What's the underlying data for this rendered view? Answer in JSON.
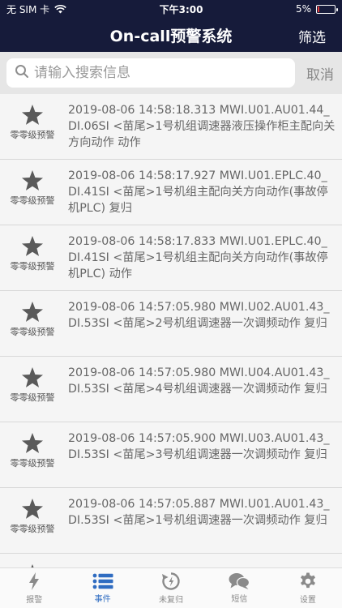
{
  "status_bar": {
    "carrier": "无 SIM 卡",
    "time": "下午3:00",
    "battery_text": "5%",
    "battery_level": 0.05,
    "battery_color": "#e23a3a"
  },
  "nav": {
    "title": "On-call预警系统",
    "filter_label": "筛选"
  },
  "search": {
    "placeholder": "请输入搜索信息",
    "cancel_label": "取消"
  },
  "alerts": [
    {
      "level": "零零级预警",
      "message": "2019-08-06 14:58:18.313 MWI.U01.AU01.44_DI.06SI <苗尾>1号机组调速器液压操作柜主配向关方向动作 动作"
    },
    {
      "level": "零零级预警",
      "message": "2019-08-06 14:58:17.927 MWI.U01.EPLC.40_DI.41SI <苗尾>1号机组主配向关方向动作(事故停机PLC) 复归"
    },
    {
      "level": "零零级预警",
      "message": "2019-08-06 14:58:17.833 MWI.U01.EPLC.40_DI.41SI <苗尾>1号机组主配向关方向动作(事故停机PLC) 动作"
    },
    {
      "level": "零零级预警",
      "message": "2019-08-06 14:57:05.980 MWI.U02.AU01.43_DI.53SI <苗尾>2号机组调速器一次调频动作 复归"
    },
    {
      "level": "零零级预警",
      "message": "2019-08-06 14:57:05.980 MWI.U04.AU01.43_DI.53SI <苗尾>4号机组调速器一次调频动作 复归"
    },
    {
      "level": "零零级预警",
      "message": "2019-08-06 14:57:05.900 MWI.U03.AU01.43_DI.53SI <苗尾>3号机组调速器一次调频动作 复归"
    },
    {
      "level": "零零级预警",
      "message": "2019-08-06 14:57:05.887 MWI.U01.AU01.43_DI.53SI <苗尾>1号机组调速器一次调频动作 复归"
    },
    {
      "level": "",
      "message": ""
    }
  ],
  "tabs": [
    {
      "label": "报警",
      "icon": "lightning-icon",
      "active": false
    },
    {
      "label": "事件",
      "icon": "list-icon",
      "active": true
    },
    {
      "label": "未复归",
      "icon": "restore-icon",
      "active": false
    },
    {
      "label": "短信",
      "icon": "chat-icon",
      "active": false
    },
    {
      "label": "设置",
      "icon": "gear-icon",
      "active": false
    }
  ],
  "colors": {
    "header_bg": "#161b3a",
    "accent": "#2f6cc1",
    "star": "#5a5a5a"
  }
}
